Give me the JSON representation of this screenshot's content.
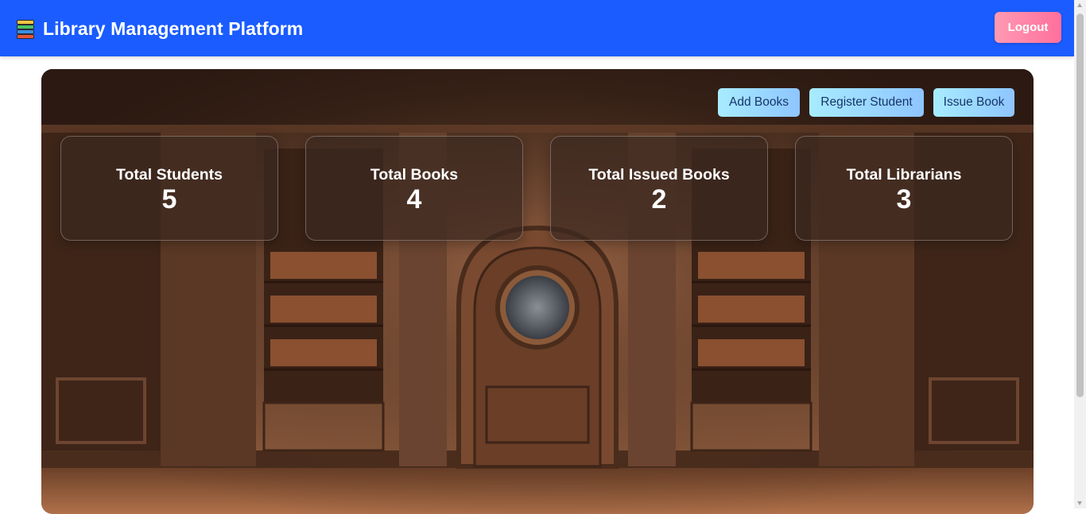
{
  "header": {
    "title": "Library Management Platform",
    "logo_icon": "books-stack-icon",
    "logout_label": "Logout"
  },
  "actions": {
    "add_books": "Add Books",
    "register_student": "Register Student",
    "issue_book": "Issue Book"
  },
  "stats": [
    {
      "label": "Total Students",
      "value": "5"
    },
    {
      "label": "Total Books",
      "value": "4"
    },
    {
      "label": "Total Issued Books",
      "value": "2"
    },
    {
      "label": "Total Librarians",
      "value": "3"
    }
  ],
  "colors": {
    "header_bg": "#1a5cff",
    "logout_gradient": [
      "#ff9ab2",
      "#ff6f9d"
    ],
    "action_gradient": [
      "#a8ecff",
      "#8ec5ff"
    ],
    "action_text": "#17356b"
  },
  "background_image": "library-interior-illustration"
}
